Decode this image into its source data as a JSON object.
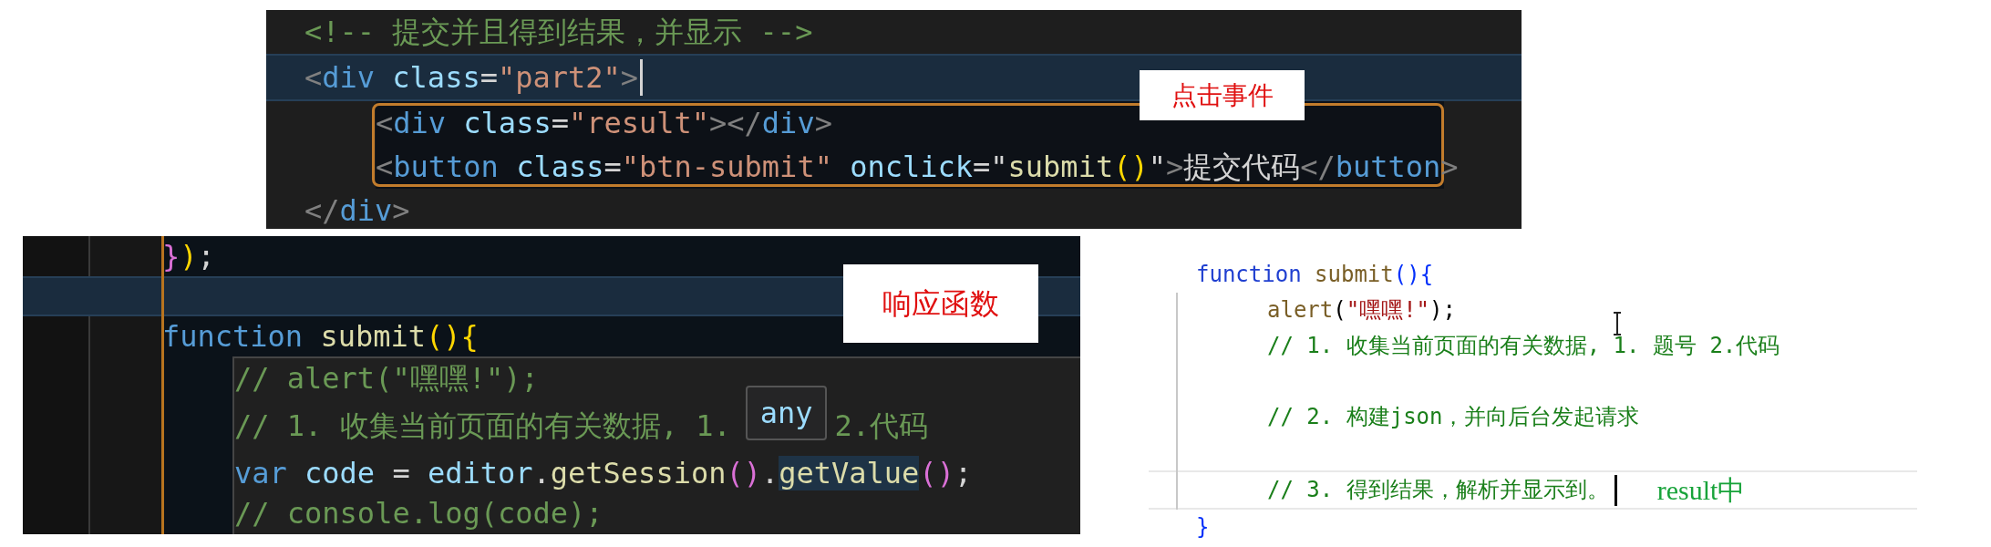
{
  "top_editor": {
    "lines": [
      {
        "kind": "code",
        "tokens": [
          {
            "kind": "comment",
            "text": "<!-- 提交并且得到结果，并显示 -->"
          }
        ]
      },
      {
        "kind": "code",
        "current": true,
        "caret": true,
        "tokens": [
          {
            "kind": "punct",
            "text": "<"
          },
          {
            "kind": "tag",
            "text": "div"
          },
          {
            "kind": "attr",
            "text": " class"
          },
          {
            "kind": "plain",
            "text": "="
          },
          {
            "kind": "string",
            "text": "\"part2\""
          },
          {
            "kind": "punct",
            "text": ">"
          }
        ]
      },
      {
        "kind": "box",
        "lines": [
          {
            "kind": "code",
            "tokens": [
              {
                "kind": "punct",
                "text": "<"
              },
              {
                "kind": "tag",
                "text": "div"
              },
              {
                "kind": "attr",
                "text": " class"
              },
              {
                "kind": "plain",
                "text": "="
              },
              {
                "kind": "string",
                "text": "\"result\""
              },
              {
                "kind": "punct",
                "text": "></"
              },
              {
                "kind": "tag",
                "text": "div"
              },
              {
                "kind": "punct",
                "text": ">"
              }
            ]
          },
          {
            "kind": "code",
            "tokens": [
              {
                "kind": "punct",
                "text": "<"
              },
              {
                "kind": "tag",
                "text": "button"
              },
              {
                "kind": "attr",
                "text": " class"
              },
              {
                "kind": "plain",
                "text": "="
              },
              {
                "kind": "string",
                "text": "\"btn-submit\""
              },
              {
                "kind": "attr",
                "text": " onclick"
              },
              {
                "kind": "plain",
                "text": "=\""
              },
              {
                "kind": "func",
                "text": "submit"
              },
              {
                "kind": "paren",
                "text": "()"
              },
              {
                "kind": "plain",
                "text": "\""
              },
              {
                "kind": "punct",
                "text": ">"
              },
              {
                "kind": "plain",
                "text": "提交代码"
              },
              {
                "kind": "punct",
                "text": "</"
              },
              {
                "kind": "tag",
                "text": "button"
              },
              {
                "kind": "punct",
                "text": ">"
              }
            ]
          }
        ]
      },
      {
        "kind": "code",
        "tokens": [
          {
            "kind": "punct",
            "text": "</"
          },
          {
            "kind": "tag",
            "text": "div"
          },
          {
            "kind": "punct",
            "text": ">"
          }
        ]
      }
    ],
    "callout": "点击事件"
  },
  "handler_editor": {
    "lines": [
      {
        "kind": "code",
        "tokens": [
          {
            "kind": "paren2",
            "text": "}"
          },
          {
            "kind": "paren",
            "text": ")"
          },
          {
            "kind": "plain",
            "text": ";"
          }
        ]
      },
      {
        "kind": "blank",
        "current": true
      },
      {
        "kind": "code",
        "tokens": [
          {
            "kind": "keyword",
            "text": "function"
          },
          {
            "kind": "func",
            "text": " submit"
          },
          {
            "kind": "paren",
            "text": "(){"
          }
        ]
      },
      {
        "kind": "popup",
        "lines": [
          {
            "kind": "code",
            "tokens": [
              {
                "kind": "comment",
                "text": "// alert(\"嘿嘿!\");"
              }
            ]
          },
          {
            "kind": "code",
            "tokens": [
              {
                "kind": "comment",
                "text": "// 1. 收集当前页面的有关数据, 1."
              }
            ],
            "tooltip": "any",
            "after": [
              {
                "kind": "comment",
                "text": "2.代码"
              }
            ]
          },
          {
            "kind": "code",
            "tokens": [
              {
                "kind": "keyword",
                "text": "var"
              },
              {
                "kind": "var",
                "text": " code"
              },
              {
                "kind": "plain",
                "text": " = "
              },
              {
                "kind": "var",
                "text": "editor"
              },
              {
                "kind": "plain",
                "text": "."
              },
              {
                "kind": "func",
                "text": "getSession"
              },
              {
                "kind": "paren2",
                "text": "()"
              },
              {
                "kind": "plain",
                "text": "."
              },
              {
                "kind": "func",
                "text": "getValue",
                "highlighted": true
              },
              {
                "kind": "paren2",
                "text": "()"
              },
              {
                "kind": "plain",
                "text": ";"
              }
            ]
          },
          {
            "kind": "code",
            "tokens": [
              {
                "kind": "comment",
                "text": "// console.log(code);"
              }
            ]
          }
        ]
      }
    ],
    "callout": "响应函数"
  },
  "preview_editor": {
    "lines": [
      {
        "kind": "code",
        "tokens": [
          {
            "kind": "keyword",
            "text": "function"
          },
          {
            "kind": "func",
            "text": " submit"
          },
          {
            "kind": "paren",
            "text": "(){"
          }
        ]
      },
      {
        "kind": "block",
        "lines": [
          {
            "kind": "code",
            "tokens": [
              {
                "kind": "func",
                "text": "alert"
              },
              {
                "kind": "plain",
                "text": "("
              },
              {
                "kind": "string",
                "text": "\"嘿嘿!\""
              },
              {
                "kind": "plain",
                "text": ");"
              }
            ]
          },
          {
            "kind": "code",
            "tokens": [
              {
                "kind": "comment",
                "text": "// 1. 收集当前页面的有关数据, 1. 题号 2.代码"
              }
            ]
          },
          {
            "kind": "blank"
          },
          {
            "kind": "code",
            "tokens": [
              {
                "kind": "comment",
                "text": "// 2. 构建json，并向后台发起请求"
              }
            ]
          },
          {
            "kind": "blank"
          },
          {
            "kind": "code",
            "current": true,
            "caret": true,
            "tokens": [
              {
                "kind": "comment",
                "text": "// 3. 得到结果，解析并显示到。"
              }
            ],
            "note": "result中"
          }
        ]
      },
      {
        "kind": "code",
        "tokens": [
          {
            "kind": "paren",
            "text": "}"
          }
        ]
      }
    ]
  }
}
